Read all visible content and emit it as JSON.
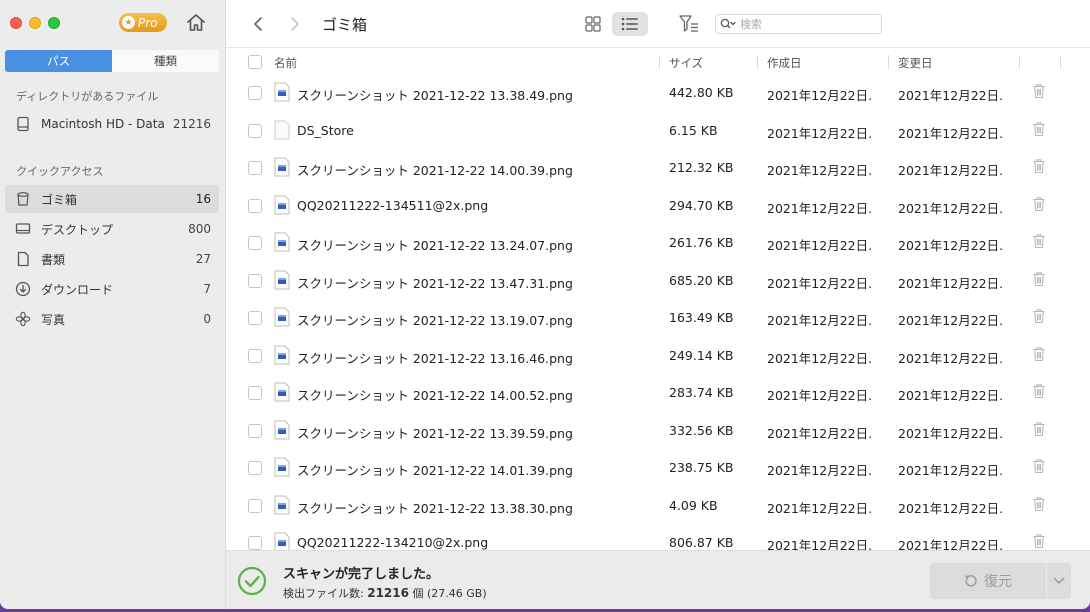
{
  "app": {
    "pro_label": "Pro"
  },
  "sidebar": {
    "tabs": [
      "パス",
      "種類"
    ],
    "section_files": "ディレクトリがあるファイル",
    "disk": {
      "label": "Macintosh HD - Data",
      "count": "21216"
    },
    "section_quick": "クイックアクセス",
    "items": [
      {
        "label": "ゴミ箱",
        "count": "16"
      },
      {
        "label": "デスクトップ",
        "count": "800"
      },
      {
        "label": "書類",
        "count": "27"
      },
      {
        "label": "ダウンロード",
        "count": "7"
      },
      {
        "label": "写真",
        "count": "0"
      }
    ]
  },
  "toolbar": {
    "title": "ゴミ箱",
    "search_placeholder": "検索"
  },
  "table": {
    "headers": {
      "name": "名前",
      "size": "サイズ",
      "created": "作成日",
      "modified": "変更日"
    },
    "rows": [
      {
        "name": "スクリーンショット 2021-12-22 13.38.49.png",
        "size": "442.80 KB",
        "created": "2021年12月22日...",
        "modified": "2021年12月22日...",
        "kind": "image"
      },
      {
        "name": "DS_Store",
        "size": "6.15 KB",
        "created": "2021年12月22日...",
        "modified": "2021年12月22日...",
        "kind": "blank"
      },
      {
        "name": "スクリーンショット 2021-12-22 14.00.39.png",
        "size": "212.32 KB",
        "created": "2021年12月22日...",
        "modified": "2021年12月22日...",
        "kind": "image"
      },
      {
        "name": "QQ20211222-134511@2x.png",
        "size": "294.70 KB",
        "created": "2021年12月22日...",
        "modified": "2021年12月22日...",
        "kind": "image"
      },
      {
        "name": "スクリーンショット 2021-12-22 13.24.07.png",
        "size": "261.76 KB",
        "created": "2021年12月22日...",
        "modified": "2021年12月22日...",
        "kind": "image"
      },
      {
        "name": "スクリーンショット 2021-12-22 13.47.31.png",
        "size": "685.20 KB",
        "created": "2021年12月22日...",
        "modified": "2021年12月22日...",
        "kind": "image"
      },
      {
        "name": "スクリーンショット 2021-12-22 13.19.07.png",
        "size": "163.49 KB",
        "created": "2021年12月22日...",
        "modified": "2021年12月22日...",
        "kind": "image"
      },
      {
        "name": "スクリーンショット 2021-12-22 13.16.46.png",
        "size": "249.14 KB",
        "created": "2021年12月22日...",
        "modified": "2021年12月22日...",
        "kind": "image"
      },
      {
        "name": "スクリーンショット 2021-12-22 14.00.52.png",
        "size": "283.74 KB",
        "created": "2021年12月22日...",
        "modified": "2021年12月22日...",
        "kind": "image"
      },
      {
        "name": "スクリーンショット 2021-12-22 13.39.59.png",
        "size": "332.56 KB",
        "created": "2021年12月22日...",
        "modified": "2021年12月22日...",
        "kind": "image"
      },
      {
        "name": "スクリーンショット 2021-12-22 14.01.39.png",
        "size": "238.75 KB",
        "created": "2021年12月22日...",
        "modified": "2021年12月22日...",
        "kind": "image"
      },
      {
        "name": "スクリーンショット 2021-12-22 13.38.30.png",
        "size": "4.09 KB",
        "created": "2021年12月22日...",
        "modified": "2021年12月22日...",
        "kind": "image"
      },
      {
        "name": "QQ20211222-134210@2x.png",
        "size": "806.87 KB",
        "created": "2021年12月22日...",
        "modified": "2021年12月22日...",
        "kind": "image"
      }
    ]
  },
  "footer": {
    "status": "スキャンが完了しました。",
    "found_label": "検出ファイル数:",
    "found_count": "21216",
    "found_unit": "個",
    "found_total": "(27.46 GB)",
    "restore_label": "復元"
  }
}
